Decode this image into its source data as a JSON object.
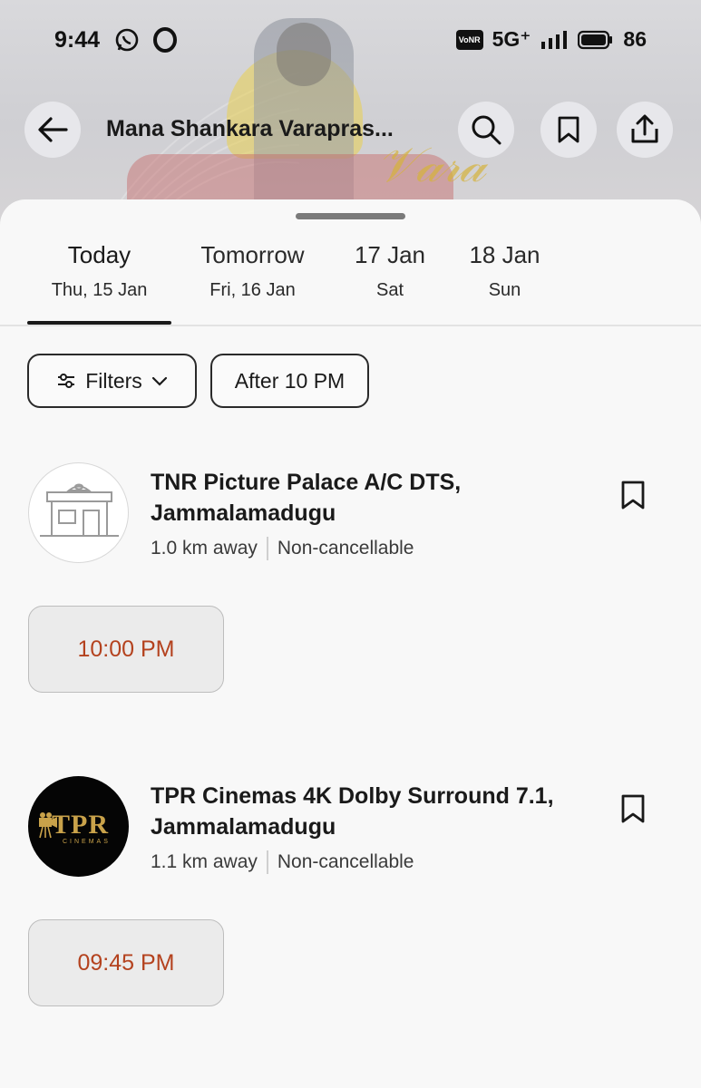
{
  "status_bar": {
    "time": "9:44",
    "network": "5G⁺",
    "vonr": "VoNR",
    "battery": "86"
  },
  "header": {
    "title": "Mana Shankara Varapras...",
    "back_icon": "back-arrow-icon",
    "search_icon": "search-icon",
    "bookmark_icon": "bookmark-icon",
    "share_icon": "share-icon"
  },
  "date_tabs": [
    {
      "label": "Today",
      "sub": "Thu, 15 Jan",
      "active": true
    },
    {
      "label": "Tomorrow",
      "sub": "Fri, 16 Jan",
      "active": false
    },
    {
      "label": "17 Jan",
      "sub": "Sat",
      "active": false
    },
    {
      "label": "18 Jan",
      "sub": "Sun",
      "active": false
    }
  ],
  "filters": {
    "filters_label": "Filters",
    "time_chip_label": "After 10 PM"
  },
  "cinemas": [
    {
      "name": "TNR Picture Palace A/C DTS, Jammalamadugu",
      "distance": "1.0 km away",
      "policy": "Non-cancellable",
      "showtimes": [
        "10:00 PM"
      ]
    },
    {
      "name": "TPR Cinemas  4K Dolby Surround 7.1,  Jammalamadugu",
      "distance": "1.1 km away",
      "policy": "Non-cancellable",
      "logo_text": "TPR",
      "logo_sub": "CINEMAS",
      "showtimes": [
        "09:45 PM"
      ]
    }
  ],
  "colors": {
    "showtime_text": "#b4421e",
    "accent_dark": "#1a1a1a"
  }
}
